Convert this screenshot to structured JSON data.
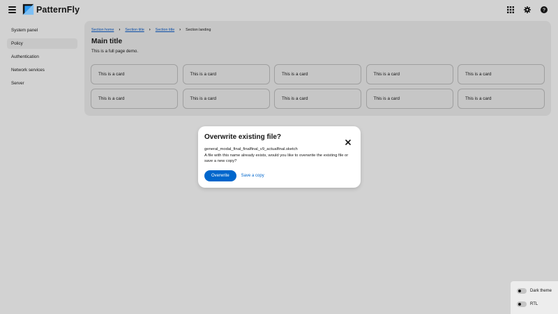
{
  "header": {
    "brand_name": "PatternFly",
    "icons": [
      "menu-icon",
      "grid-icon",
      "gear-icon",
      "help-icon"
    ]
  },
  "sidebar": {
    "items": [
      {
        "label": "System panel",
        "active": false
      },
      {
        "label": "Policy",
        "active": true
      },
      {
        "label": "Authentication",
        "active": false
      },
      {
        "label": "Network services",
        "active": false
      },
      {
        "label": "Server",
        "active": false
      }
    ]
  },
  "main": {
    "breadcrumb": [
      "Section home",
      "Section title",
      "Section title",
      "Section landing"
    ],
    "title": "Main title",
    "subtitle": "This is a full page demo.",
    "cards": [
      "This is a card",
      "This is a card",
      "This is a card",
      "This is a card",
      "This is a card",
      "This is a card",
      "This is a card",
      "This is a card",
      "This is a card",
      "This is a card"
    ]
  },
  "modal": {
    "title": "Overwrite existing file?",
    "filename": "general_modal_final_finalfinal_v9_actualfinal.sketch",
    "message": "A file with this name already exists, would you like to overwrite the existing file or save a new copy?",
    "primary_label": "Overwrite",
    "secondary_label": "Save a copy"
  },
  "theme": {
    "dark_label": "Dark theme",
    "rtl_label": "RTL"
  },
  "colors": {
    "primary": "#0066cc",
    "link": "#0b4ea8",
    "backdrop": "#d2d2d2"
  }
}
